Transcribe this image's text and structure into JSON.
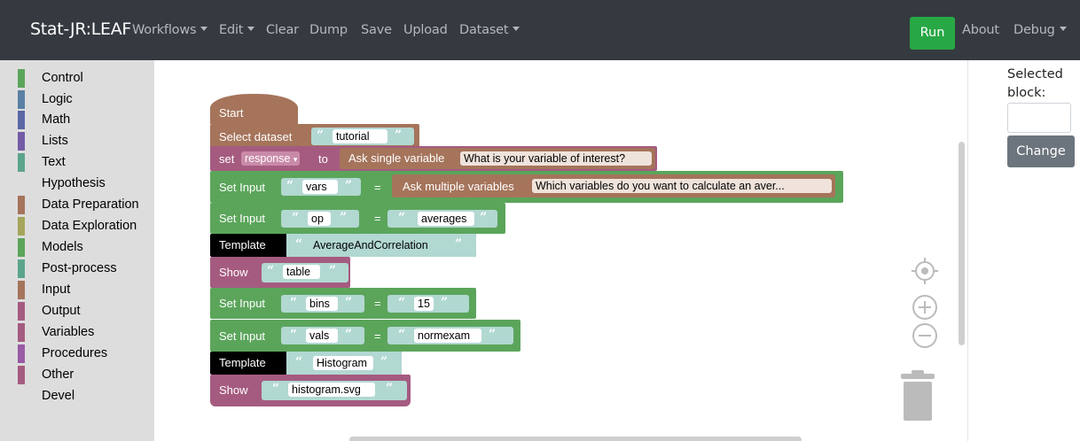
{
  "navbar": {
    "brand": "Stat-JR:LEAF",
    "menu": [
      {
        "label": "Workflows",
        "dropdown": true
      },
      {
        "label": "Edit",
        "dropdown": true
      },
      {
        "label": "Clear",
        "dropdown": false
      },
      {
        "label": "Dump",
        "dropdown": false
      },
      {
        "label": "Save",
        "dropdown": false
      },
      {
        "label": "Upload",
        "dropdown": false
      },
      {
        "label": "Dataset",
        "dropdown": true
      }
    ],
    "run": "Run",
    "about": "About",
    "debug": "Debug"
  },
  "toolbox": {
    "categories": [
      {
        "label": "Control",
        "color": "#5ba55b"
      },
      {
        "label": "Logic",
        "color": "#5b80a5"
      },
      {
        "label": "Math",
        "color": "#5b67a5"
      },
      {
        "label": "Lists",
        "color": "#745ba5"
      },
      {
        "label": "Text",
        "color": "#5ba58c"
      },
      {
        "label": "Hypothesis",
        "color": ""
      },
      {
        "label": "Data Preparation",
        "color": "#a5745b"
      },
      {
        "label": "Data Exploration",
        "color": "#a5a55b"
      },
      {
        "label": "Models",
        "color": "#5ba55b"
      },
      {
        "label": "Post-process",
        "color": "#5ba58c"
      },
      {
        "label": "Input",
        "color": "#a5745b"
      },
      {
        "label": "Output",
        "color": "#a55b80"
      },
      {
        "label": "Variables",
        "color": "#a55b80"
      },
      {
        "label": "Procedures",
        "color": "#995ba5"
      },
      {
        "label": "Other",
        "color": "#a55b80"
      },
      {
        "label": "Devel",
        "color": ""
      }
    ]
  },
  "blocks": {
    "start": "Start",
    "select_dataset": {
      "label": "Select dataset",
      "value": "tutorial"
    },
    "set_var": {
      "label": "set",
      "var": "response",
      "to": "to",
      "ask": "Ask single variable",
      "prompt": "What is your variable of interest?"
    },
    "set_input_1": {
      "label": "Set Input",
      "key": "vars",
      "eq": "=",
      "ask": "Ask multiple variables",
      "prompt": "Which variables do you want to calculate an aver..."
    },
    "set_input_2": {
      "label": "Set Input",
      "key": "op",
      "eq": "=",
      "value": "averages"
    },
    "template_1": {
      "label": "Template",
      "value": "AverageAndCorrelation"
    },
    "show_1": {
      "label": "Show",
      "value": "table"
    },
    "set_input_3": {
      "label": "Set Input",
      "key": "bins",
      "eq": "=",
      "value": "15"
    },
    "set_input_4": {
      "label": "Set Input",
      "key": "vals",
      "eq": "=",
      "value": "normexam"
    },
    "template_2": {
      "label": "Template",
      "value": "Histogram"
    },
    "show_2": {
      "label": "Show",
      "value": "histogram.svg"
    }
  },
  "side": {
    "selected_label": "Selected block:",
    "selected_value": "",
    "change": "Change"
  },
  "colors": {
    "navbar": "#343a40",
    "run": "#28a745",
    "change": "#6c757d",
    "input_block": "#a5745b",
    "set_input_block": "#5ba55b",
    "template_block": "#000000",
    "show_block": "#a55b80",
    "text_block": "#b2d8d2"
  }
}
